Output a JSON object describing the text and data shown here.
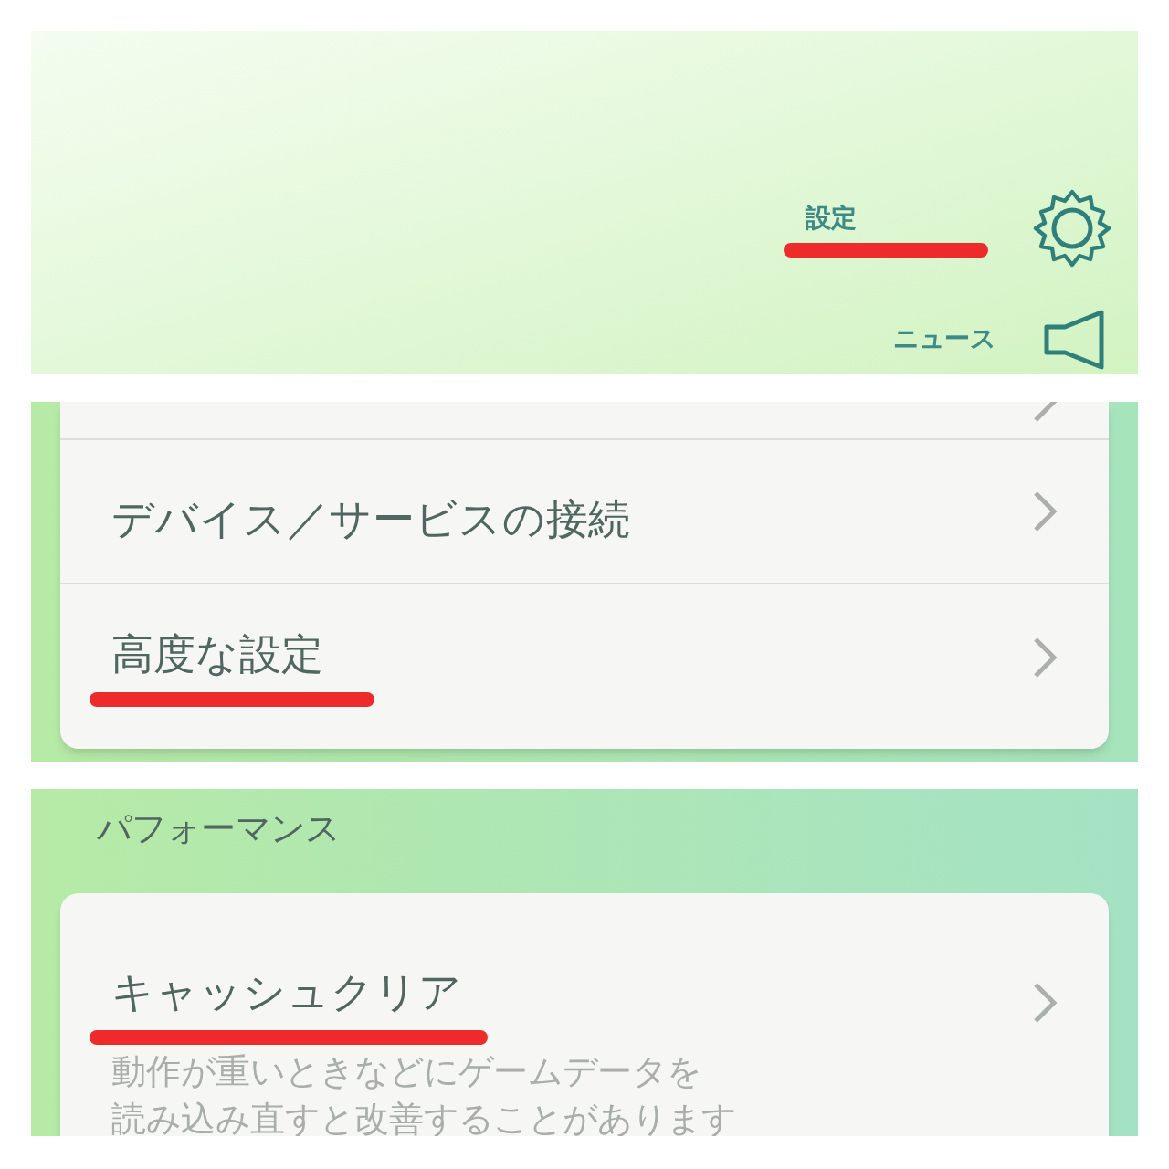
{
  "header": {
    "items": [
      {
        "kind": "settings",
        "label": "設定",
        "marked": true
      },
      {
        "kind": "news",
        "label": "ニュース",
        "marked": false
      }
    ]
  },
  "connections_list": {
    "rows": [
      {
        "marked": false
      },
      {
        "label": "デバイス／サービスの接続",
        "marked": false
      },
      {
        "label": "高度な設定",
        "marked": true
      }
    ]
  },
  "performance": {
    "heading": "パフォーマンス",
    "item": {
      "label": "キャッシュクリア",
      "marked": true,
      "description": [
        "動作が重いときなどにゲームデータを",
        "読み込み直すと改善することがあります"
      ]
    }
  }
}
